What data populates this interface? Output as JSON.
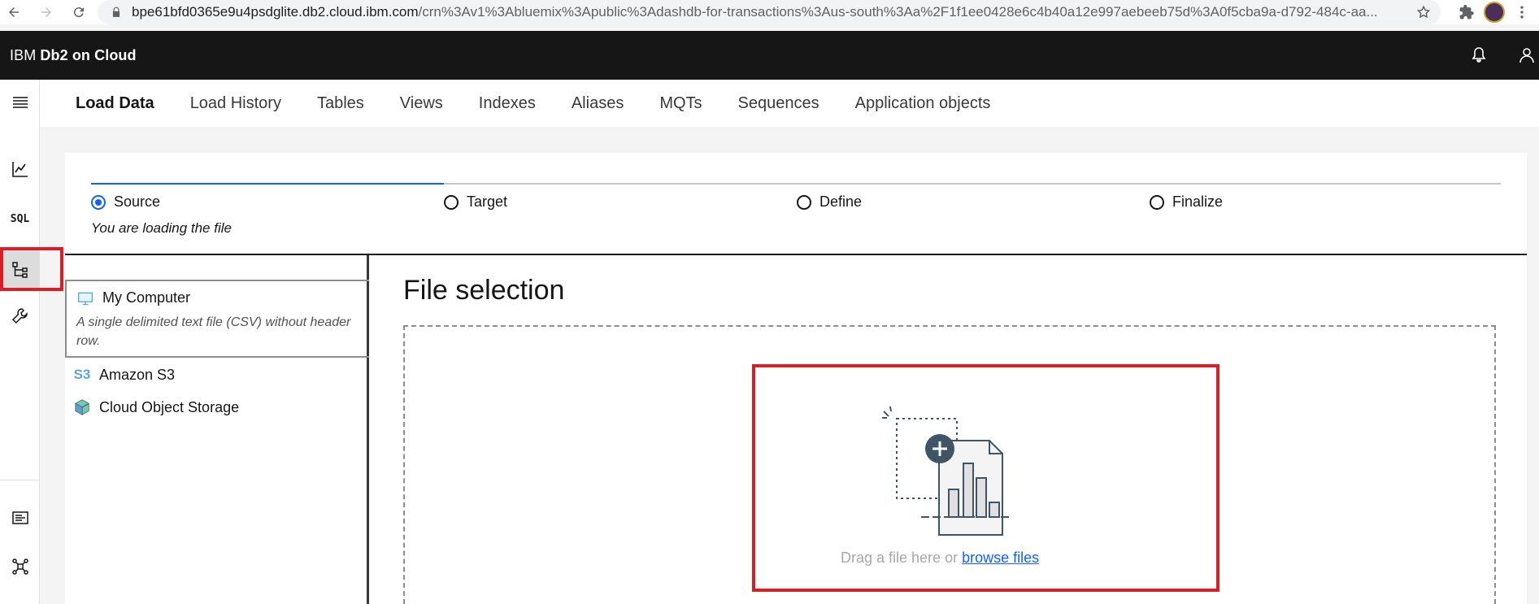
{
  "browser": {
    "url_host": "bpe61bfd0365e9u4psdglite.db2.cloud.ibm.com",
    "url_path": "/crn%3Av1%3Abluemix%3Apublic%3Adashdb-for-transactions%3Aus-south%3Aa%2F1f1ee0428e6c4b40a12e997aebeeb75d%3A0f5cba9a-d792-484c-aa..."
  },
  "header": {
    "brand_prefix": "IBM",
    "brand_product": "Db2 on Cloud"
  },
  "tabs": [
    {
      "label": "Load Data",
      "active": true
    },
    {
      "label": "Load History"
    },
    {
      "label": "Tables"
    },
    {
      "label": "Views"
    },
    {
      "label": "Indexes"
    },
    {
      "label": "Aliases"
    },
    {
      "label": "MQTs"
    },
    {
      "label": "Sequences"
    },
    {
      "label": "Application objects"
    }
  ],
  "rail": {
    "sql_label": "SQL"
  },
  "steps": [
    {
      "label": "Source",
      "state": "current"
    },
    {
      "label": "Target",
      "state": "incomplete"
    },
    {
      "label": "Define",
      "state": "incomplete"
    },
    {
      "label": "Finalize",
      "state": "incomplete"
    }
  ],
  "step_subtitle": "You are loading the file",
  "sources": [
    {
      "label": "My Computer",
      "description": "A single delimited text file (CSV) without header row.",
      "icon": "monitor-icon"
    },
    {
      "label": "Amazon S3",
      "icon": "s3-icon",
      "icon_text": "S3"
    },
    {
      "label": "Cloud Object Storage",
      "icon": "cube-icon"
    }
  ],
  "file_selection": {
    "title": "File selection",
    "drop_text": "Drag a file here or",
    "browse_link": "browse files"
  },
  "colors": {
    "accent": "#0f62fe",
    "highlight": "#da1e28",
    "header_bg": "#161616"
  }
}
